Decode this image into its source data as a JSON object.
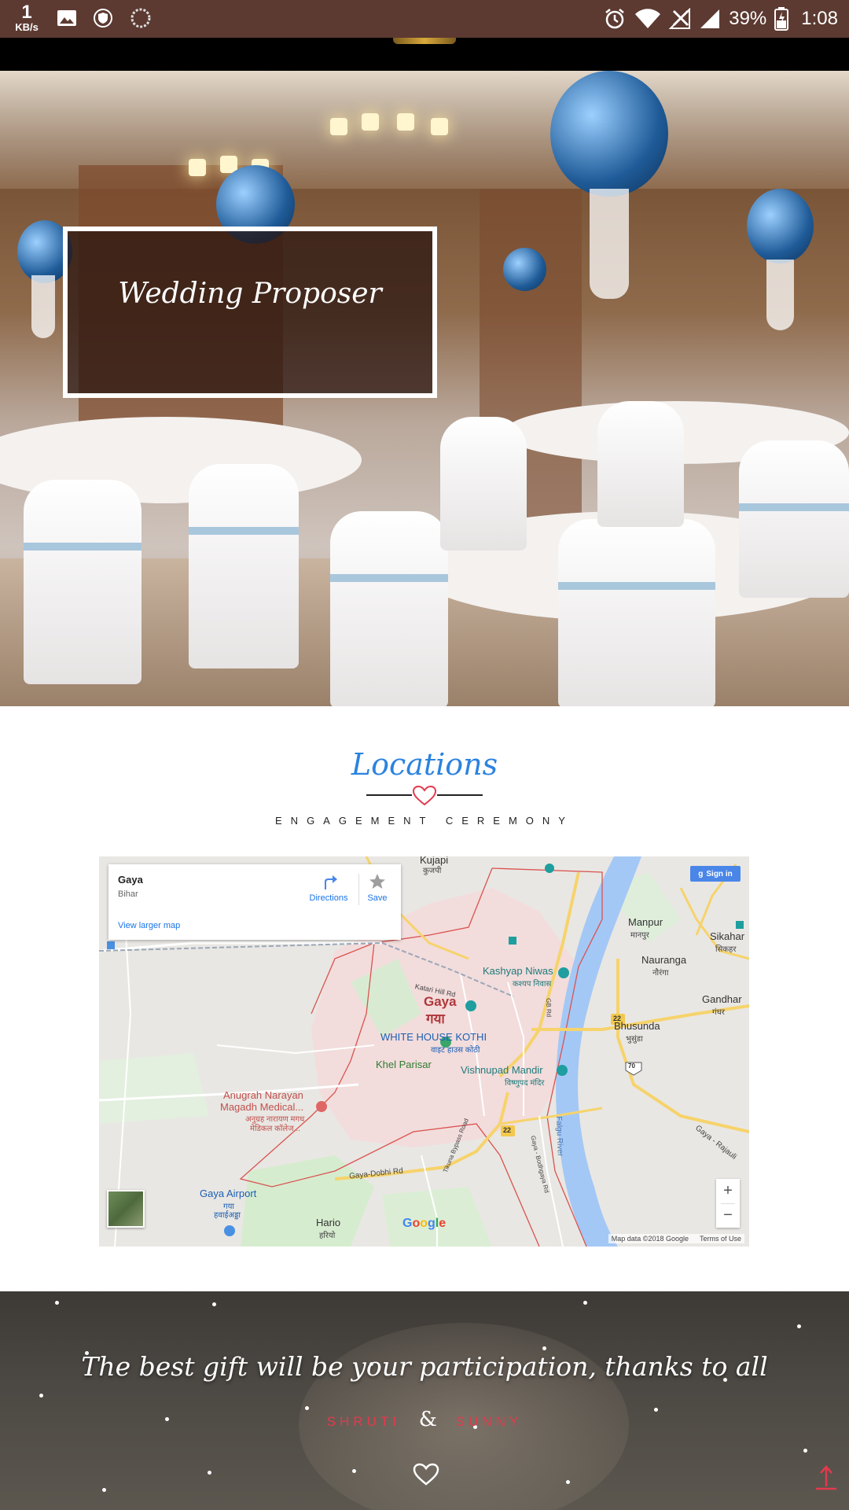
{
  "status_bar": {
    "speed_value": "1",
    "speed_unit": "KB/s",
    "battery": "39%",
    "time": "1:08",
    "icons": [
      "image-icon",
      "shield-icon",
      "loading-icon",
      "alarm-icon",
      "wifi-icon",
      "no-signal-icon",
      "signal-icon",
      "battery-icon"
    ]
  },
  "hero": {
    "title": "Wedding Proposer"
  },
  "locations": {
    "title": "Locations",
    "subtitle": "ENGAGEMENT CEREMONY"
  },
  "map": {
    "info_card": {
      "place": "Gaya",
      "region": "Bihar",
      "directions_label": "Directions",
      "save_label": "Save",
      "larger_map_label": "View larger map"
    },
    "sign_in_label": "Sign in",
    "zoom_in": "+",
    "zoom_out": "−",
    "footer_data": "Map data ©2018 Google",
    "footer_terms": "Terms of Use",
    "labels": {
      "city": "Gaya",
      "city_hi": "गया",
      "kashyap": "Kashyap Niwas",
      "kashyap_hi": "कश्यप निवास",
      "white_house": "WHITE HOUSE KOTHI",
      "white_house_hi": "वाइट हाउस कोठी",
      "khel": "Khel Parisar",
      "vishnupad": "Vishnupad Mandir",
      "vishnupad_hi": "विष्णुपद मंदिर",
      "anugrah": "Anugrah Narayan",
      "magadh": "Magadh Medical...",
      "anugrah_hi": "अनुग्रह नारायण मगध",
      "anugrah_hi2": "मेडिकल कॉलेज...",
      "airport": "Gaya Airport",
      "airport_hi": "गया",
      "airport_hi2": "हवाईअड्डा",
      "hario": "Hario",
      "hario_hi": "हरियो",
      "manpur": "Manpur",
      "manpur_hi": "मानपुर",
      "sikahar": "Sikahar",
      "sikahar_hi": "सिकहर",
      "nauranga": "Nauranga",
      "nauranga_hi": "नौरंगा",
      "gandhar": "Gandhar",
      "gandhar_hi": "गंधर",
      "bhusunda": "Bhusunda",
      "bhusunda_hi": "भुसुंडा",
      "kujapi": "Kujapi",
      "kujapi_hi": "कुजपी",
      "gaya_dobhi": "Gaya-Dobhi Rd",
      "falgu": "Falgu River",
      "gaya_rajauli": "Gaya - Rajauli",
      "katari": "Katari Hill Rd",
      "tikuna": "Tikuna Bypass Road",
      "gaya_bodhgaya": "Gaya - Bodhgaya Rd",
      "gb": "GB Rd",
      "highway_22a": "22",
      "highway_22b": "22",
      "highway_70": "70",
      "google": "Google"
    }
  },
  "footer": {
    "thanks": "The best gift will be your participation, thanks to all",
    "name1": "SHRUTI",
    "amp": "&",
    "name2": "SUNNY"
  },
  "colors": {
    "accent_blue": "#2b83e0",
    "accent_red": "#e23a4d",
    "status_bar": "#5c3a31"
  }
}
